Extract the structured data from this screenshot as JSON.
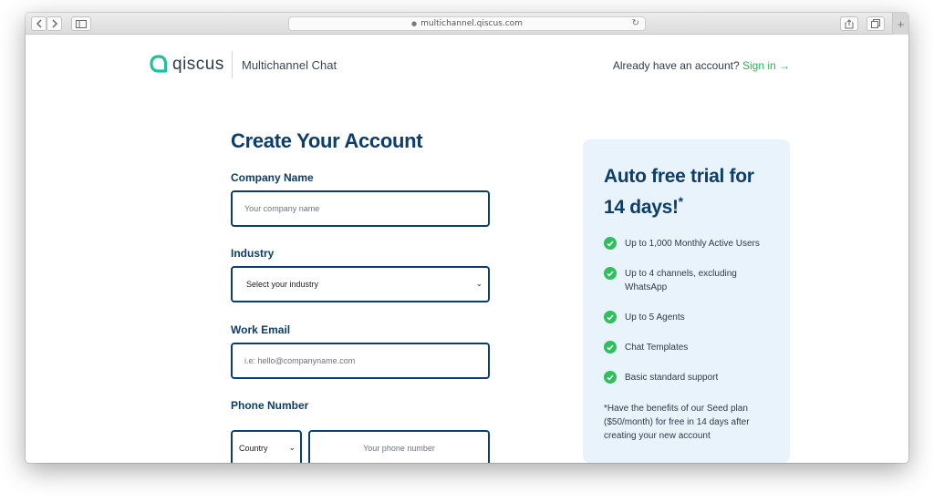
{
  "browser": {
    "url": "multichannel.qiscus.com"
  },
  "header": {
    "logo_text": "qiscus",
    "product_name": "Multichannel Chat",
    "signin_prompt": "Already have an account?",
    "signin_link": "Sign in →"
  },
  "form": {
    "title": "Create Your Account",
    "company_label": "Company Name",
    "company_placeholder": "Your company name",
    "industry_label": "Industry",
    "industry_selected": "Select your industry",
    "email_label": "Work Email",
    "email_placeholder": "i.e: hello@companyname.com",
    "phone_label": "Phone Number",
    "country_selected": "Country",
    "phone_placeholder": "Your phone number"
  },
  "promo": {
    "title": "Auto free trial for 14 days!",
    "title_mark": "*",
    "benefits": [
      "Up to 1,000 Monthly Active Users",
      "Up to 4 channels, excluding WhatsApp",
      "Up to 5 Agents",
      "Chat Templates",
      "Basic standard support"
    ],
    "note": "*Have the benefits of our Seed plan ($50/month) for free in 14 days after creating your new account"
  },
  "colors": {
    "brand_navy": "#0c3d6b",
    "accent_green": "#27b35a",
    "promo_background": "#e8f3fb"
  },
  "icons": {
    "logo": "qiscus-logo-icon",
    "check": "check-circle-icon",
    "select_caret": "chevron-down-icon"
  }
}
